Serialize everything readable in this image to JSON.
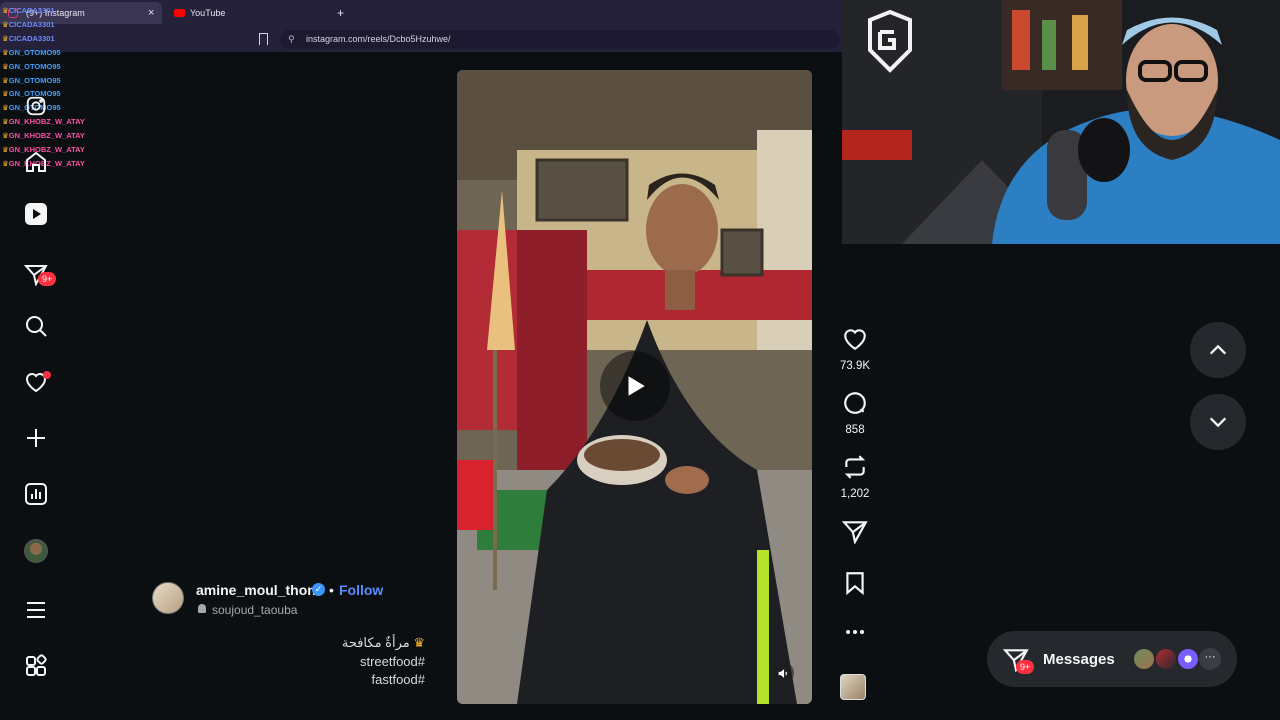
{
  "browser": {
    "tabs": [
      {
        "label": "(9+) Instagram",
        "close": "×"
      },
      {
        "label": "YouTube"
      }
    ],
    "new_tab": "+",
    "url": "instagram.com/reels/Dcbo5Hzuhwe/"
  },
  "chat_overlay": {
    "lines": [
      {
        "user": "CICADA3301",
        "color": "#6a8cff"
      },
      {
        "user": "CICADA3301",
        "color": "#6a8cff"
      },
      {
        "user": "CICADA3301",
        "color": "#6a8cff"
      },
      {
        "user": "GN_OTOMO95",
        "color": "#3fa0ff"
      },
      {
        "user": "GN_OTOMO95",
        "color": "#3fa0ff"
      },
      {
        "user": "GN_OTOMO95",
        "color": "#3fa0ff"
      },
      {
        "user": "GN_OTOMO95",
        "color": "#3fa0ff"
      },
      {
        "user": "GN_OTOMO95",
        "color": "#3fa0ff"
      },
      {
        "user": "GN_KHOBZ_W_ATAY",
        "color": "#ff4fa3"
      },
      {
        "user": "GN_KHOBZ_W_ATAY",
        "color": "#ff4fa3"
      },
      {
        "user": "GN_KHOBZ_W_ATAY",
        "color": "#ff4fa3"
      },
      {
        "user": "GN_KHOBZ_W_ATAY",
        "color": "#ff4fa3"
      }
    ]
  },
  "sidebar": {
    "notification_badge": "9+"
  },
  "reel": {
    "author": "amine_moul_thon",
    "follow_separator": "•",
    "follow_label": "Follow",
    "audio": "soujoud_taouba",
    "caption_lines": [
      "مرأةٌ مكافحة",
      "streetfood#",
      "fastfood#"
    ]
  },
  "actions": {
    "likes": "73.9K",
    "comments": "858",
    "reposts": "1,202"
  },
  "messages": {
    "label": "Messages",
    "badge": "9+"
  },
  "colors": {
    "background": "#0c0f12",
    "accent_follow": "#5b8cff",
    "badge": "#ff3040",
    "verified": "#3b94ff"
  }
}
